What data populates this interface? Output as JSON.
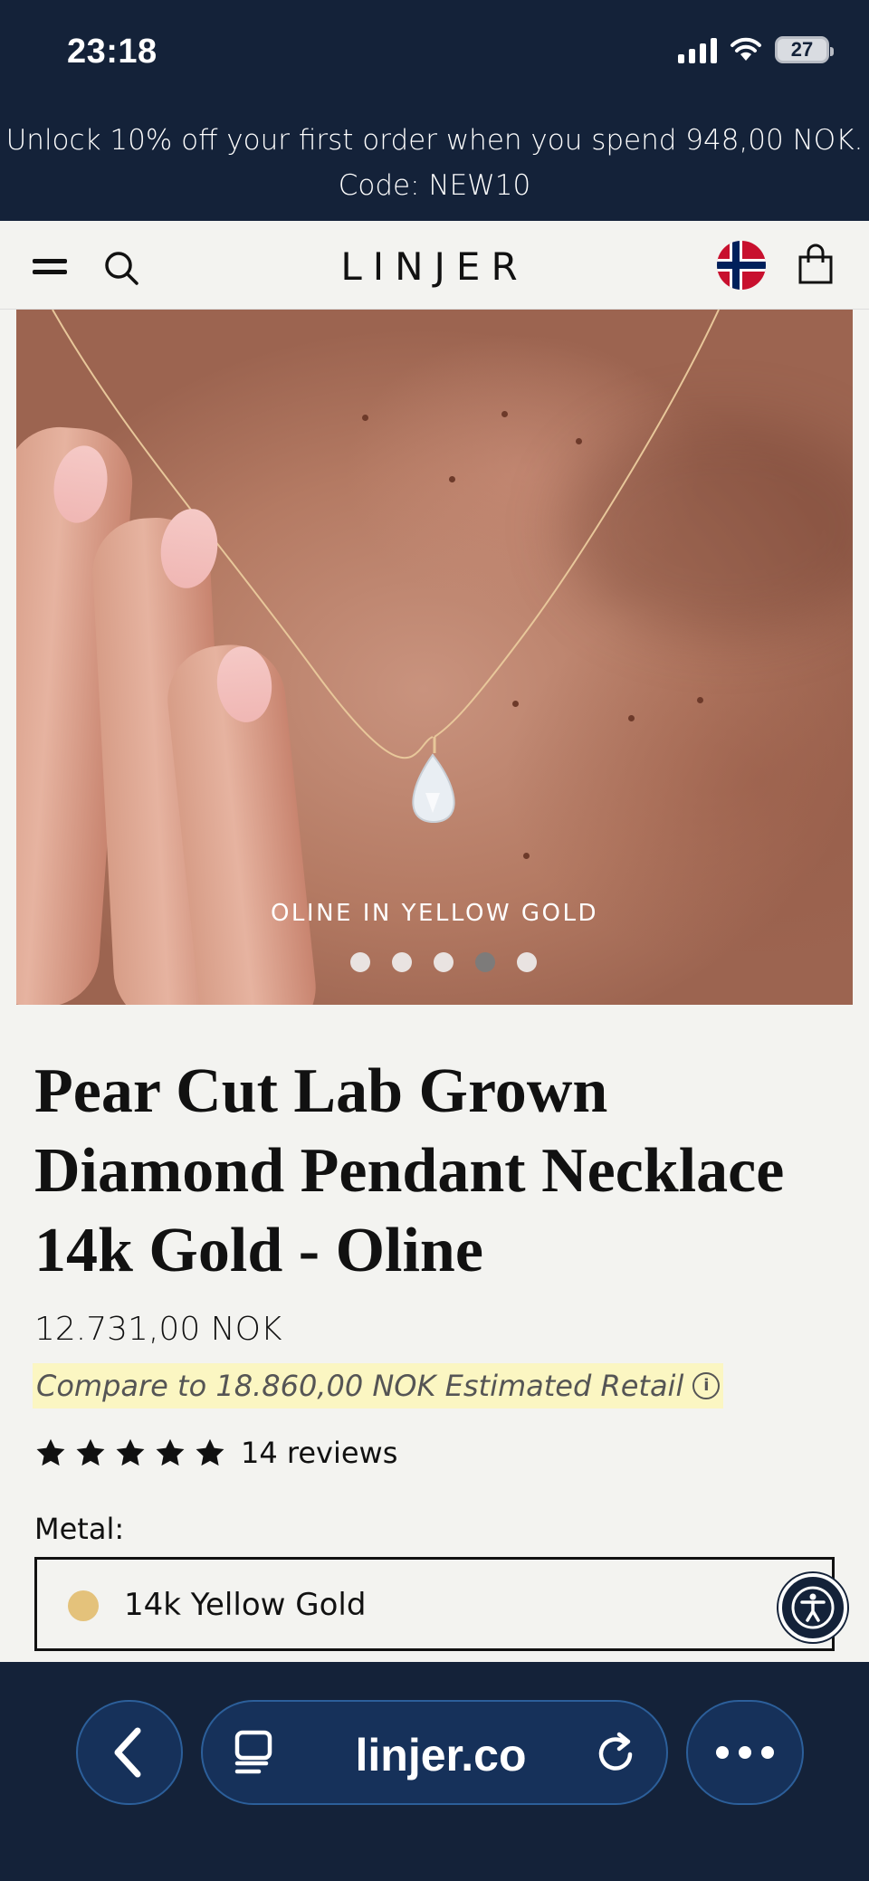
{
  "status_bar": {
    "time": "23:18",
    "battery": "27"
  },
  "promo": {
    "line1": "Unlock 10% off your first order when you spend 948,00 NOK.",
    "line2": "Code: NEW10"
  },
  "header": {
    "brand": "LINJER"
  },
  "hero": {
    "caption": "OLINE IN YELLOW GOLD",
    "slide_count": 5,
    "active_slide": 4
  },
  "product": {
    "title": "Pear Cut Lab Grown Diamond Pendant Necklace 14k Gold - Oline",
    "price": "12.731,00 NOK",
    "compare": "Compare to 18.860,00 NOK Estimated Retail",
    "rating": 5,
    "reviews": "14 reviews",
    "metal_label": "Metal:",
    "metal_value": "14k Yellow Gold"
  },
  "browser": {
    "url": "linjer.co"
  },
  "colors": {
    "navy": "#142239",
    "highlight": "#fbf6c2",
    "swatch_gold": "#e4c27b",
    "background": "#f3f3f0"
  }
}
